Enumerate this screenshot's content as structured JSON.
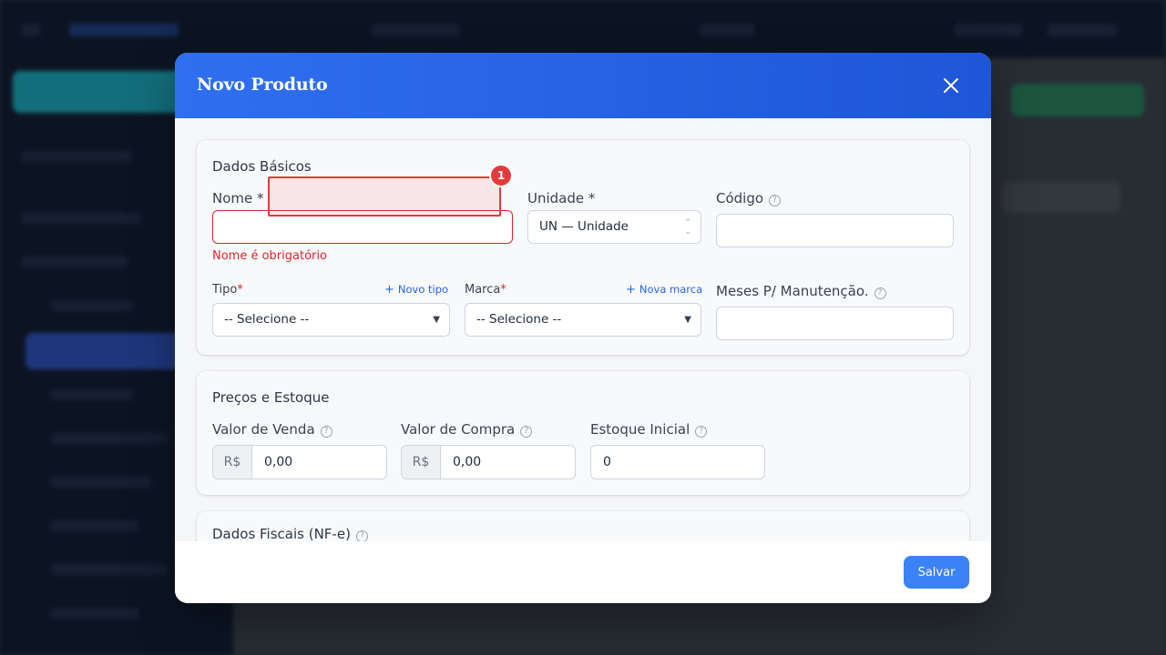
{
  "modal": {
    "title": "Novo Produto",
    "close_icon": "close-icon",
    "save_label": "Salvar"
  },
  "dados_basicos": {
    "title": "Dados Básicos",
    "nome": {
      "label": "Nome",
      "required_mark": "*",
      "value": "",
      "error": "Nome é obrigatório"
    },
    "unidade": {
      "label": "Unidade",
      "required_mark": "*",
      "selected": "UN — Unidade"
    },
    "codigo": {
      "label": "Código",
      "help_icon": "question-circle-icon",
      "value": ""
    },
    "tipo": {
      "label": "Tipo",
      "required_mark": "*",
      "selected": "-- Selecione --",
      "add_link": "Novo tipo"
    },
    "marca": {
      "label": "Marca",
      "required_mark": "*",
      "selected": "-- Selecione --",
      "add_link": "Nova marca"
    },
    "meses": {
      "label": "Meses P/ Manutenção.",
      "help_icon": "question-circle-icon",
      "value": ""
    }
  },
  "precos_estoque": {
    "title": "Preços e Estoque",
    "valor_venda": {
      "label": "Valor de Venda",
      "prefix": "R$",
      "value": "0,00"
    },
    "valor_compra": {
      "label": "Valor de Compra",
      "prefix": "R$",
      "value": "0,00"
    },
    "estoque_inicial": {
      "label": "Estoque Inicial",
      "value": "0"
    }
  },
  "dados_fiscais": {
    "title": "Dados Fiscais (NF-e)"
  },
  "annotation": {
    "badge": "1"
  },
  "colors": {
    "primary": "#2f6ff0",
    "error": "#dc2626",
    "save": "#3b82f6"
  }
}
